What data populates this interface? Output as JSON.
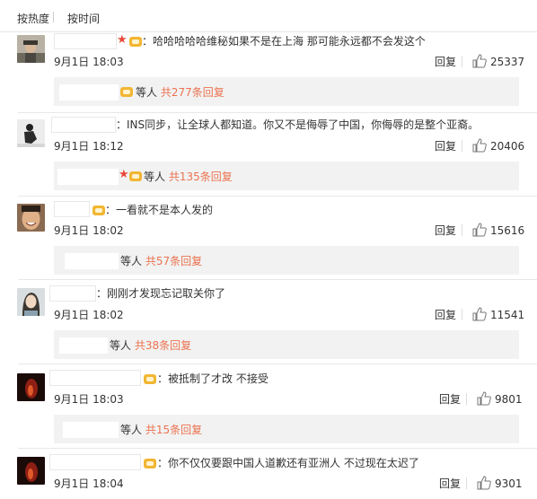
{
  "sort": {
    "by_hot": "按热度",
    "by_time": "按时间"
  },
  "reply_label": "回复",
  "sub_suffix": "等人",
  "colors": {
    "link": "#eb7350",
    "crown": "#e8483a",
    "vip": "#f2b632"
  },
  "comments": [
    {
      "text": "：哈哈哈哈哈维秘如果不是在上海 那可能永远都不会发这个",
      "time": "9月1日 18:03",
      "likes": "25337",
      "sub_count": "共277条回复",
      "avatar_icon": "avatar-man-hat"
    },
    {
      "text": "：INS同步，让全球人都知道。你又不是侮辱了中国，你侮辱的是整个亚裔。",
      "time": "9月1日 18:12",
      "likes": "20406",
      "sub_count": "共135条回复",
      "avatar_icon": "avatar-person-crouching"
    },
    {
      "text": "：一看就不是本人发的",
      "time": "9月1日 18:02",
      "likes": "15616",
      "sub_count": "共57条回复",
      "avatar_icon": "avatar-smiling-face"
    },
    {
      "text": "：刚刚才发现忘记取关你了",
      "time": "9月1日 18:02",
      "likes": "11541",
      "sub_count": "共38条回复",
      "avatar_icon": "avatar-woman-portrait"
    },
    {
      "text": "：被抵制了才改 不接受",
      "time": "9月1日 18:03",
      "likes": "9801",
      "sub_count": "共15条回复",
      "avatar_icon": "avatar-dark-red"
    },
    {
      "text": "：你不仅仅要跟中国人道歉还有亚洲人 不过现在太迟了",
      "time": "9月1日 18:04",
      "likes": "9301",
      "sub_count": "",
      "avatar_icon": "avatar-dark-red"
    }
  ]
}
